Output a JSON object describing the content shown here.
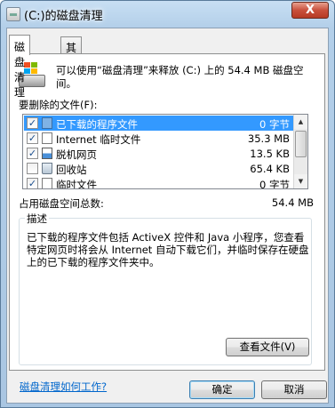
{
  "window": {
    "title": "(C:)的磁盘清理",
    "close_label": "X"
  },
  "tabs": [
    {
      "label": "磁盘清理"
    },
    {
      "label": "其他选项"
    }
  ],
  "intro": {
    "text": "可以使用“磁盘清理”来释放 (C:) 上的 54.4 MB 磁盘空间。"
  },
  "files": {
    "label": "要删除的文件(F):",
    "items": [
      {
        "checked": true,
        "name": "已下载的程序文件",
        "size": "0 字节",
        "icon": "folder-icon"
      },
      {
        "checked": true,
        "name": "Internet 临时文件",
        "size": "35.3 MB",
        "icon": "page-icon"
      },
      {
        "checked": true,
        "name": "脱机网页",
        "size": "13.5 KB",
        "icon": "offline-page-icon"
      },
      {
        "checked": false,
        "name": "回收站",
        "size": "65.4 KB",
        "icon": "recycle-bin-icon"
      },
      {
        "checked": true,
        "name": "临时文件",
        "size": "0 字节",
        "icon": "page-icon"
      }
    ]
  },
  "total": {
    "label": "占用磁盘空间总数:",
    "value": "54.4 MB"
  },
  "description": {
    "legend": "描述",
    "text": "已下载的程序文件包括 ActiveX 控件和 Java 小程序，您查看特定网页时将会从 Internet 自动下载它们，并临时保存在硬盘上的已下载的程序文件夹中。"
  },
  "buttons": {
    "view_files": "查看文件(V)",
    "ok": "确定",
    "cancel": "取消"
  },
  "help_link": "磁盘清理如何工作?",
  "colors": {
    "selection": "#3399ff",
    "link": "#0066cc"
  }
}
